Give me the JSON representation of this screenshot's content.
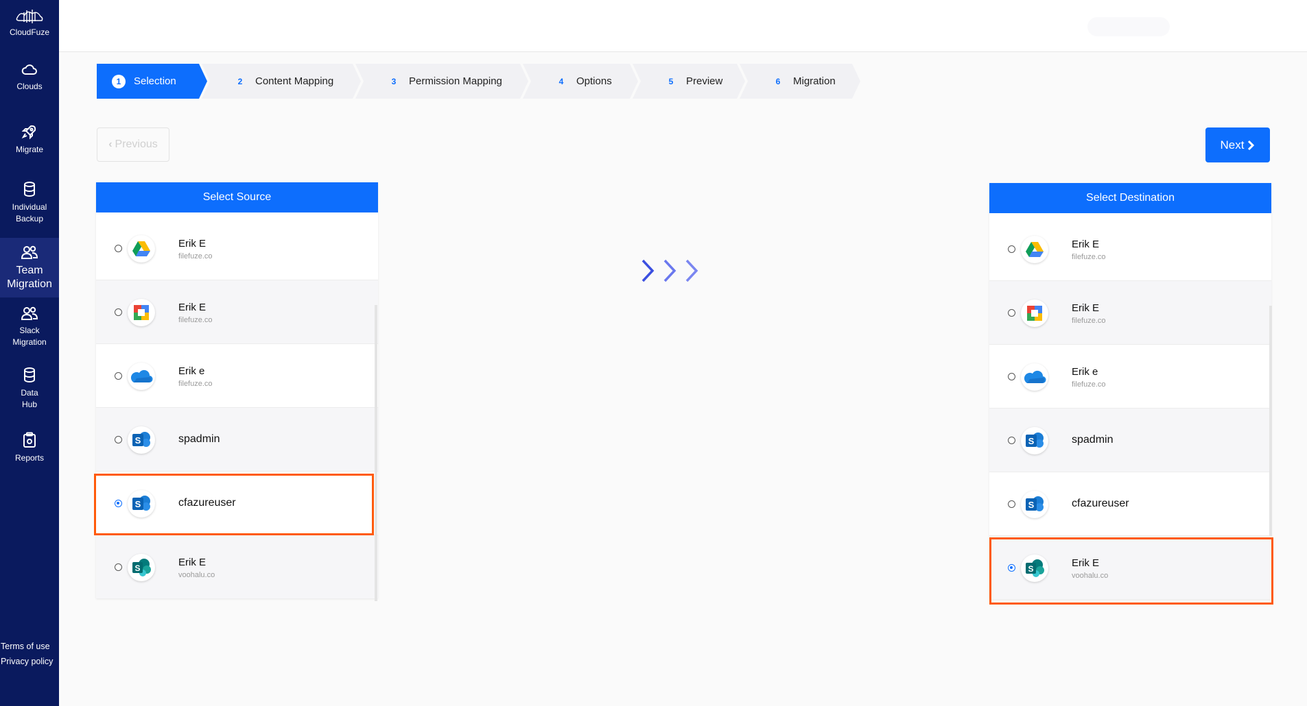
{
  "sidebar": {
    "brand": "CloudFuze",
    "items": [
      {
        "label": "Clouds"
      },
      {
        "label": "Migrate"
      },
      {
        "label": "Individual Backup"
      },
      {
        "label": "Team Migration"
      },
      {
        "label": "Slack Migration"
      },
      {
        "label": "Data Hub"
      },
      {
        "label": "Reports"
      }
    ],
    "terms": "Terms of use",
    "privacy": "Privacy policy"
  },
  "steps": [
    {
      "num": "1",
      "label": "Selection"
    },
    {
      "num": "2",
      "label": "Content Mapping"
    },
    {
      "num": "3",
      "label": "Permission Mapping"
    },
    {
      "num": "4",
      "label": "Options"
    },
    {
      "num": "5",
      "label": "Preview"
    },
    {
      "num": "6",
      "label": "Migration"
    }
  ],
  "buttons": {
    "previous": "Previous",
    "next": "Next"
  },
  "source": {
    "title": "Select Source",
    "items": [
      {
        "name": "Erik E",
        "email": "filefuze.co",
        "icon": "google-drive-icon",
        "selected": false
      },
      {
        "name": "Erik E",
        "email": "filefuze.co",
        "icon": "google-workspace-icon",
        "selected": false
      },
      {
        "name": "Erik e",
        "email": "filefuze.co",
        "icon": "onedrive-icon",
        "selected": false
      },
      {
        "name": "spadmin",
        "email": "",
        "icon": "sharepoint-icon",
        "selected": false
      },
      {
        "name": "cfazureuser",
        "email": "",
        "icon": "sharepoint-icon",
        "selected": true
      },
      {
        "name": "Erik E",
        "email": "voohalu.co",
        "icon": "sharepoint-online-icon",
        "selected": false
      }
    ]
  },
  "destination": {
    "title": "Select Destination",
    "items": [
      {
        "name": "Erik E",
        "email": "filefuze.co",
        "icon": "google-drive-icon",
        "selected": false
      },
      {
        "name": "Erik E",
        "email": "filefuze.co",
        "icon": "google-workspace-icon",
        "selected": false
      },
      {
        "name": "Erik e",
        "email": "filefuze.co",
        "icon": "onedrive-icon",
        "selected": false
      },
      {
        "name": "spadmin",
        "email": "",
        "icon": "sharepoint-icon",
        "selected": false
      },
      {
        "name": "cfazureuser",
        "email": "",
        "icon": "sharepoint-icon",
        "selected": false
      },
      {
        "name": "Erik E",
        "email": "voohalu.co",
        "icon": "sharepoint-online-icon",
        "selected": true
      }
    ]
  },
  "colors": {
    "primary": "#0d6efd",
    "sidebar": "#0a1a5e",
    "highlight": "#ff5a0a"
  }
}
